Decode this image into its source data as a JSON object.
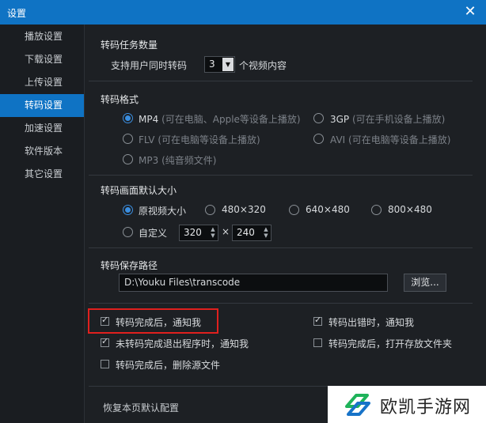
{
  "window": {
    "title": "设置",
    "close_glyph": "✕"
  },
  "sidebar": {
    "items": [
      {
        "label": "播放设置"
      },
      {
        "label": "下载设置"
      },
      {
        "label": "上传设置"
      },
      {
        "label": "转码设置",
        "active": true
      },
      {
        "label": "加速设置"
      },
      {
        "label": "软件版本"
      },
      {
        "label": "其它设置"
      }
    ]
  },
  "tasks": {
    "title": "转码任务数量",
    "prefix": "支持用户同时转码",
    "value": "3",
    "suffix": "个视频内容"
  },
  "format": {
    "title": "转码格式",
    "options": [
      {
        "name": "MP4",
        "desc": "(可在电脑、Apple等设备上播放)",
        "selected": true
      },
      {
        "name": "3GP",
        "desc": "(可在手机设备上播放)",
        "selected": false
      },
      {
        "name": "FLV",
        "desc": "(可在电脑等设备上播放)",
        "selected": false
      },
      {
        "name": "AVI",
        "desc": "(可在电脑等设备上播放)",
        "selected": false
      },
      {
        "name": "MP3",
        "desc": "(纯音频文件)",
        "selected": false
      }
    ]
  },
  "size": {
    "title": "转码画面默认大小",
    "options": [
      {
        "label": "原视频大小",
        "selected": true
      },
      {
        "label": "480×320",
        "selected": false
      },
      {
        "label": "640×480",
        "selected": false
      },
      {
        "label": "800×480",
        "selected": false
      }
    ],
    "custom_label": "自定义",
    "custom_width": "320",
    "times": "×",
    "custom_height": "240"
  },
  "path": {
    "title": "转码保存路径",
    "value": "D:\\Youku Files\\transcode",
    "browse": "浏览..."
  },
  "notify": {
    "items": [
      {
        "label": "转码完成后，通知我",
        "checked": true
      },
      {
        "label": "转码出错时，通知我",
        "checked": true
      },
      {
        "label": "未转码完成退出程序时，通知我",
        "checked": true
      },
      {
        "label": "转码完成后，打开存放文件夹",
        "checked": false
      },
      {
        "label": "转码完成后，删除源文件",
        "checked": false
      }
    ]
  },
  "footer": {
    "restore": "恢复本页默认配置"
  },
  "watermark": {
    "text": "欧凯手游网"
  },
  "colors": {
    "accent": "#0f73c4",
    "highlight": "#e0201e",
    "background": "#1d2024"
  }
}
